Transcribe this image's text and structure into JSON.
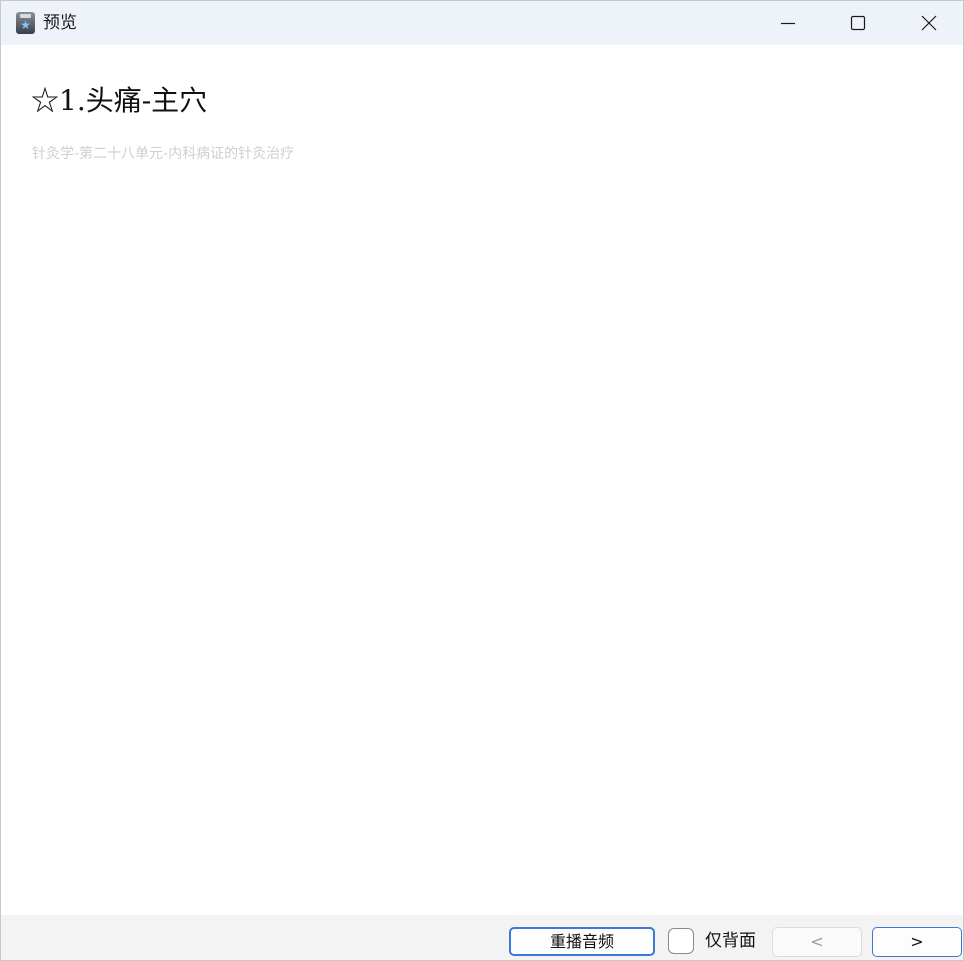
{
  "window": {
    "title": "预览"
  },
  "card": {
    "title": "☆1.头痛-主穴",
    "subtitle": "针灸学-第二十八单元-内科病证的针灸治疗"
  },
  "footer": {
    "replay_label": "重播音频",
    "back_only_label": "仅背面",
    "back_only_checked": false,
    "prev_label": "<",
    "next_label": ">"
  },
  "colors": {
    "titlebar_bg": "#eef3fa",
    "accent_border": "#3b78d8",
    "subtitle_text": "#cfcfcf",
    "footer_bg": "#f3f3f3"
  },
  "icons": {
    "app": "anki-star-icon",
    "minimize": "minimize-icon",
    "maximize": "maximize-icon",
    "close": "close-icon"
  }
}
